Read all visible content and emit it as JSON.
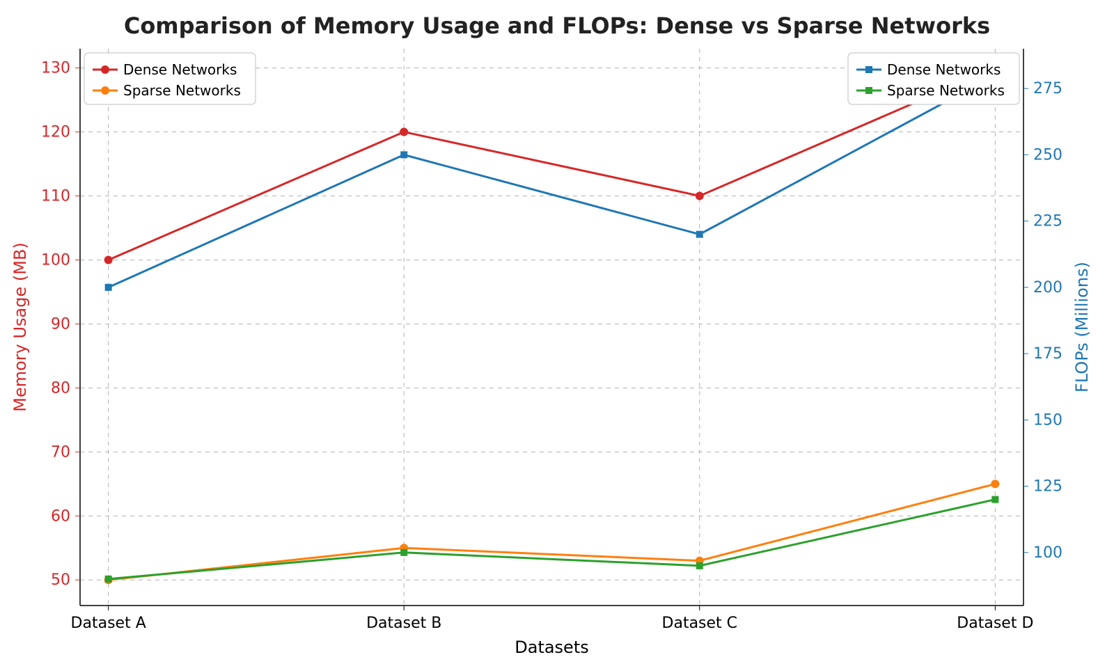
{
  "chart_data": {
    "type": "line",
    "title": "Comparison of Memory Usage and FLOPs: Dense vs Sparse Networks",
    "xlabel": "Datasets",
    "ylabel_left": "Memory Usage (MB)",
    "ylabel_right": "FLOPs (Millions)",
    "categories": [
      "Dataset A",
      "Dataset B",
      "Dataset C",
      "Dataset D"
    ],
    "left_axis": {
      "color": "#d62728",
      "ylim": [
        46,
        133
      ],
      "ticks": [
        50,
        60,
        70,
        80,
        90,
        100,
        110,
        120,
        130
      ]
    },
    "right_axis": {
      "color": "#1f77b4",
      "ylim": [
        80,
        290
      ],
      "ticks": [
        100,
        125,
        150,
        175,
        200,
        225,
        250,
        275
      ]
    },
    "series_left": [
      {
        "name": "Dense Networks",
        "color": "#d62728",
        "marker": "circle",
        "values": [
          100,
          120,
          110,
          130
        ]
      },
      {
        "name": "Sparse Networks",
        "color": "#ff7f0e",
        "marker": "circle",
        "values": [
          50,
          55,
          53,
          65
        ]
      }
    ],
    "series_right": [
      {
        "name": "Dense Networks",
        "color": "#1f77b4",
        "marker": "square",
        "values": [
          200,
          250,
          220,
          280
        ]
      },
      {
        "name": "Sparse Networks",
        "color": "#2ca02c",
        "marker": "square",
        "values": [
          90,
          100,
          95,
          120
        ]
      }
    ],
    "legends": {
      "left": {
        "position": "upper-left",
        "entries": [
          "Dense Networks",
          "Sparse Networks"
        ]
      },
      "right": {
        "position": "upper-right",
        "entries": [
          "Dense Networks",
          "Sparse Networks"
        ]
      }
    }
  }
}
